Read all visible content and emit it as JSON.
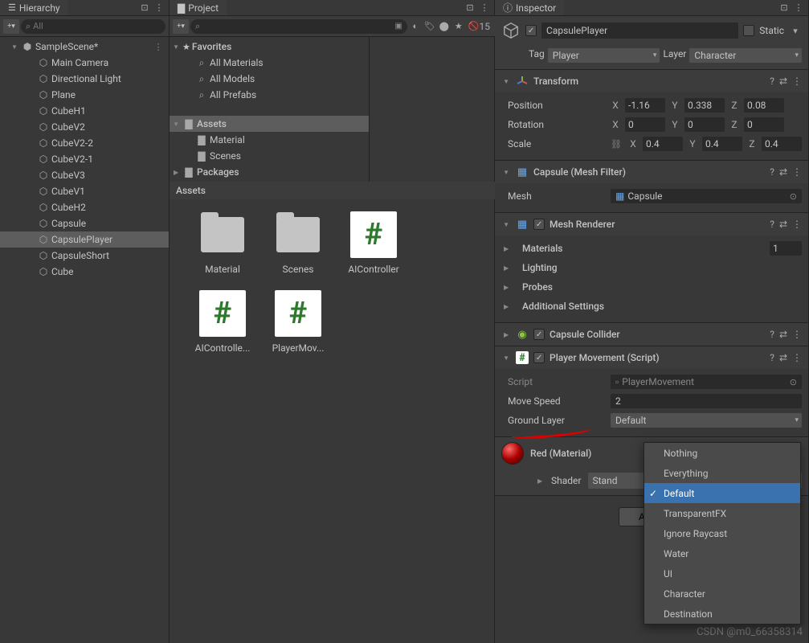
{
  "hierarchy": {
    "tab": "Hierarchy",
    "search_placeholder": "All",
    "scene": "SampleScene*",
    "items": [
      "Main Camera",
      "Directional Light",
      "Plane",
      "CubeH1",
      "CubeV2",
      "CubeV2-2",
      "CubeV2-1",
      "CubeV3",
      "CubeV1",
      "CubeH2",
      "Capsule",
      "CapsulePlayer",
      "CapsuleShort",
      "Cube"
    ],
    "selected": "CapsulePlayer"
  },
  "project": {
    "tab": "Project",
    "vis_count": "15",
    "favorites": "Favorites",
    "fav_items": [
      "All Materials",
      "All Models",
      "All Prefabs"
    ],
    "assets": "Assets",
    "asset_tree": [
      "Material",
      "Scenes"
    ],
    "packages": "Packages",
    "assets_header": "Assets",
    "grid": [
      {
        "type": "folder",
        "label": "Material"
      },
      {
        "type": "folder",
        "label": "Scenes"
      },
      {
        "type": "script",
        "label": "AIController"
      },
      {
        "type": "script",
        "label": "AIControlle..."
      },
      {
        "type": "script",
        "label": "PlayerMov..."
      }
    ]
  },
  "inspector": {
    "tab": "Inspector",
    "name": "CapsulePlayer",
    "static_label": "Static",
    "tag_label": "Tag",
    "tag_value": "Player",
    "layer_label": "Layer",
    "layer_value": "Character",
    "transform": {
      "title": "Transform",
      "position": "Position",
      "rotation": "Rotation",
      "scale": "Scale",
      "pos": {
        "x": "-1.16",
        "y": "0.338",
        "z": "0.08"
      },
      "rot": {
        "x": "0",
        "y": "0",
        "z": "0"
      },
      "scl": {
        "x": "0.4",
        "y": "0.4",
        "z": "0.4"
      }
    },
    "meshfilter": {
      "title": "Capsule (Mesh Filter)",
      "field": "Mesh",
      "value": "Capsule"
    },
    "meshrenderer": {
      "title": "Mesh Renderer",
      "materials": "Materials",
      "mat_count": "1",
      "lighting": "Lighting",
      "probes": "Probes",
      "additional": "Additional Settings"
    },
    "capsulecollider": {
      "title": "Capsule Collider"
    },
    "script": {
      "title": "Player Movement (Script)",
      "script_label": "Script",
      "script_value": "PlayerMovement",
      "speed_label": "Move Speed",
      "speed_value": "2",
      "layer_label": "Ground Layer",
      "layer_value": "Default"
    },
    "material": {
      "title": "Red (Material)",
      "shader_label": "Shader",
      "shader_value": "Stand"
    },
    "add_component": "Add C",
    "layer_options": [
      "Nothing",
      "Everything",
      "Default",
      "TransparentFX",
      "Ignore Raycast",
      "Water",
      "UI",
      "Character",
      "Destination"
    ],
    "layer_selected": "Default"
  },
  "watermark": "CSDN @m0_66358314"
}
